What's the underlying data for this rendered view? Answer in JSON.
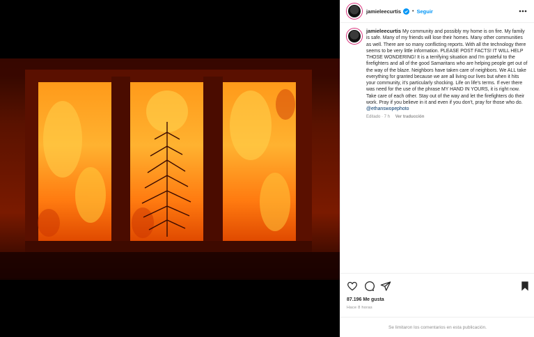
{
  "post": {
    "username": "jamieleecurtis",
    "follow_label": "Seguir",
    "separator": "•",
    "caption_text": "My community and possibly my home is on fire. My family is safe. Many of my friends will lose their homes. Many other communities as well. There are so many conflicting reports. With all the technology there seems to be very little information. PLEASE POST FACTS! IT WILL HELP THOSE WONDERING! It is a terrifying situation and I'm grateful to the firefighters and all of the good Samaritans who are helping people get out of the way of the blaze. Neighbors have taken care of neighbors. We ALL take everything for granted because we are all living our lives but when it hits your community, it's particularly shocking. Life on life's terms. If ever there was need for the use of the phrase MY HAND IN YOURS, it is right now. Take care of each other. Stay out of the way and let the firefighters do their work. Pray if you believe in it and even if you don't, pray for those who do.",
    "mention": "@ethanswopephoto",
    "edited_time": "Editado · 7 h",
    "translate_label": "Ver traducción",
    "likes": "87.196 Me gusta",
    "posted_ago": "Hace 8 horas",
    "comments_disabled": "Se limitaron los comentarios en esta publicación."
  },
  "icons": {
    "verified": "verified-badge-icon",
    "more": "more-options-icon",
    "like": "heart-icon",
    "comment": "comment-icon",
    "share": "share-icon",
    "save": "bookmark-icon"
  },
  "colors": {
    "accent": "#0095f6",
    "text": "#262626",
    "muted": "#8e8e8e",
    "mention": "#00376b"
  }
}
